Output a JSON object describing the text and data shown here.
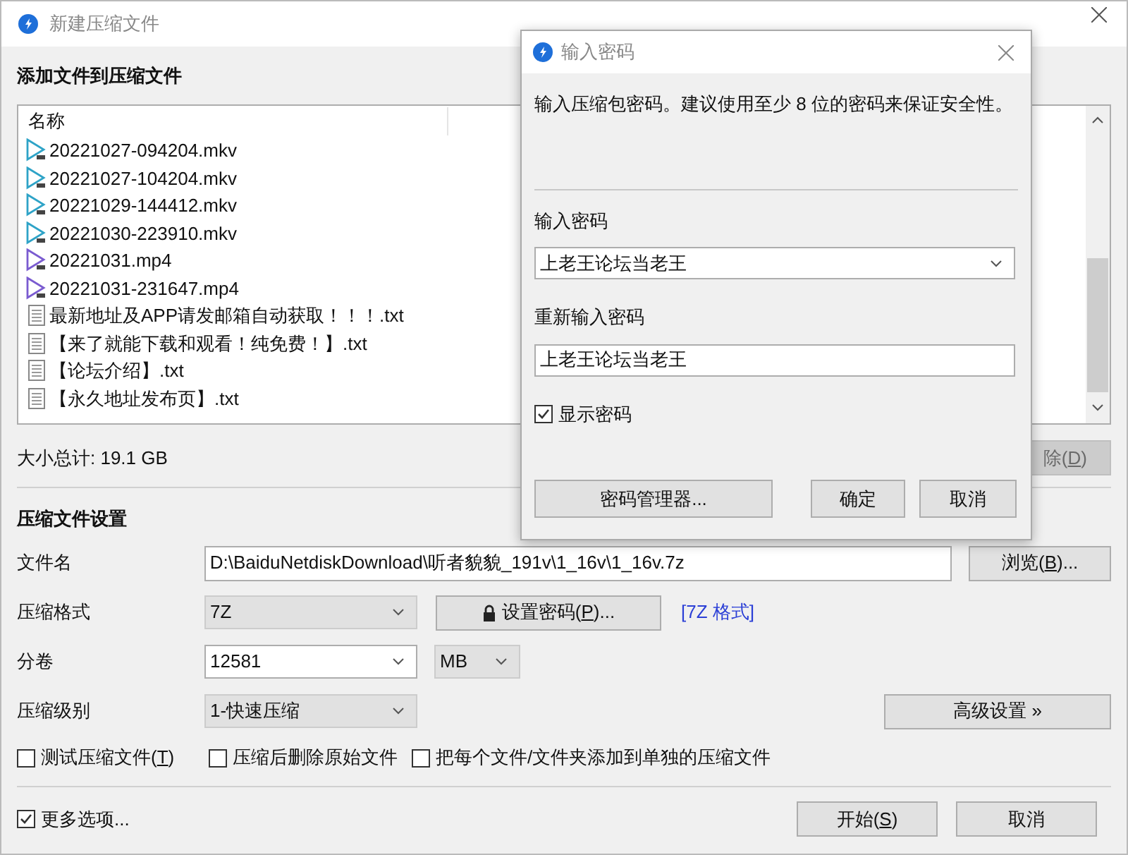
{
  "window": {
    "title": "新建压缩文件"
  },
  "files_section": {
    "title": "添加文件到压缩文件",
    "column_1": "名称",
    "rows": [
      {
        "name": "20221027-094204.mkv",
        "kind": "mkv"
      },
      {
        "name": "20221027-104204.mkv",
        "kind": "mkv"
      },
      {
        "name": "20221029-144412.mkv",
        "kind": "mkv"
      },
      {
        "name": "20221030-223910.mkv",
        "kind": "mkv"
      },
      {
        "name": "20221031.mp4",
        "kind": "mp4"
      },
      {
        "name": "20221031-231647.mp4",
        "kind": "mp4"
      },
      {
        "name": "最新地址及APP请发邮箱自动获取！！！.txt",
        "kind": "txt"
      },
      {
        "name": "【来了就能下载和观看！纯免费！】.txt",
        "kind": "txt"
      },
      {
        "name": "【论坛介绍】.txt",
        "kind": "txt"
      },
      {
        "name": "【永久地址发布页】.txt",
        "kind": "txt"
      }
    ]
  },
  "total_size": "大小总计: 19.1 GB",
  "remove_button": {
    "before": "除(",
    "key": "D",
    "after": ")",
    "disabled": true
  },
  "settings": {
    "title": "压缩文件设置",
    "file_name": {
      "label": "文件名",
      "value": "D:\\BaiduNetdiskDownload\\听者貌貌_191v\\1_16v\\1_16v.7z"
    },
    "browse_button": {
      "before": "浏览(",
      "key": "B",
      "after": ")..."
    },
    "format": {
      "label": "压缩格式",
      "value": "7Z"
    },
    "password_button": {
      "before": "设置密码(",
      "key": "P",
      "after": ")..."
    },
    "format_link": "[7Z 格式]",
    "split": {
      "label": "分卷",
      "value": "12581",
      "unit": "MB"
    },
    "level": {
      "label": "压缩级别",
      "value": "1-快速压缩"
    },
    "advanced_button": "高级设置 »",
    "options": [
      {
        "before": "测试压缩文件(",
        "key": "T",
        "after": ")",
        "checked": false
      },
      {
        "before": "压缩后删除原始文件",
        "checked": false
      },
      {
        "before": "把每个文件/文件夹添加到单独的压缩文件",
        "checked": false
      }
    ]
  },
  "more_options": {
    "label": "更多选项...",
    "checked": true
  },
  "start_button": {
    "before": "开始(",
    "key": "S",
    "after": ")"
  },
  "cancel_button": "取消",
  "dialog": {
    "title": "输入密码",
    "message": "输入压缩包密码。建议使用至少 8 位的密码来保证安全性。",
    "password_label": "输入密码",
    "password": "上老王论坛当老王",
    "repeat_label": "重新输入密码",
    "repeat": "上老王论坛当老王",
    "show_password": {
      "label": "显示密码",
      "checked": true
    },
    "buttons": [
      "密码管理器...",
      "确定",
      "取消"
    ]
  }
}
